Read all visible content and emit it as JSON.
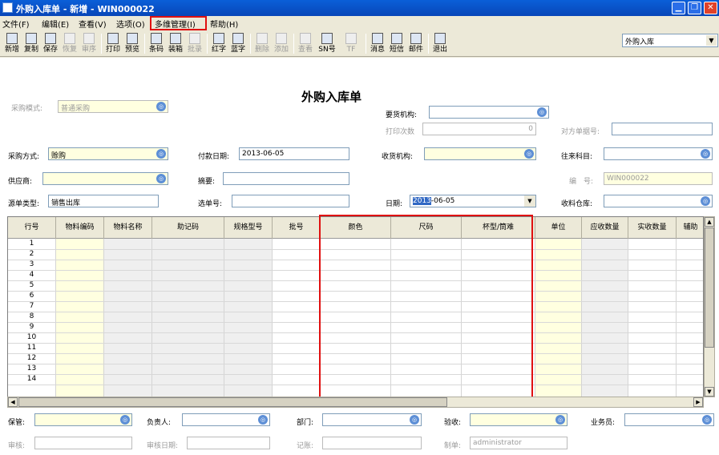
{
  "window": {
    "title": "外购入库单 - 新增 - WIN000022"
  },
  "menu": [
    "文件(F)",
    "编辑(E)",
    "查看(V)",
    "选项(O)",
    "多维管理(I)",
    "帮助(H)"
  ],
  "toolbar": {
    "buttons": [
      {
        "label": "新增",
        "icon": "new-doc-icon",
        "enabled": true
      },
      {
        "label": "复制",
        "icon": "copy-icon",
        "enabled": true
      },
      {
        "label": "保存",
        "icon": "save-icon",
        "enabled": true
      },
      {
        "label": "恢复",
        "icon": "undo-icon",
        "enabled": false
      },
      {
        "label": "审序",
        "icon": "sequence-icon",
        "enabled": false
      },
      {
        "label": "打印",
        "icon": "print-icon",
        "enabled": true
      },
      {
        "label": "预览",
        "icon": "preview-icon",
        "enabled": true
      },
      {
        "label": "条码",
        "icon": "barcode-icon",
        "enabled": true
      },
      {
        "label": "装箱",
        "icon": "box-icon",
        "enabled": true
      },
      {
        "label": "批录",
        "icon": "batch-icon",
        "enabled": false
      },
      {
        "label": "红字",
        "icon": "red-doc-icon",
        "enabled": true
      },
      {
        "label": "蓝字",
        "icon": "blue-doc-icon",
        "enabled": true
      },
      {
        "label": "删除",
        "icon": "delete-row-icon",
        "enabled": false
      },
      {
        "label": "添加",
        "icon": "add-row-icon",
        "enabled": false
      },
      {
        "label": "查看",
        "icon": "view-icon",
        "enabled": false
      },
      {
        "label": "SN号",
        "icon": "sn-icon",
        "enabled": true
      },
      {
        "label": "TF",
        "icon": "tf-icon",
        "enabled": false
      },
      {
        "label": "消息",
        "icon": "message-icon",
        "enabled": true
      },
      {
        "label": "短信",
        "icon": "sms-icon",
        "enabled": true
      },
      {
        "label": "邮件",
        "icon": "mail-icon",
        "enabled": true
      },
      {
        "label": "退出",
        "icon": "exit-icon",
        "enabled": true
      }
    ],
    "doc_type_select": "外购入库"
  },
  "form": {
    "doc_title": "外购入库单",
    "purchase_mode_label": "采购模式:",
    "purchase_mode_value": "普通采购",
    "request_org_label": "要货机构:",
    "request_org_value": "",
    "print_count_label": "打印次数",
    "print_count_value": "0",
    "counterparty_no_label": "对方单据号:",
    "counterparty_no_value": "",
    "purchase_method_label": "采购方式:",
    "purchase_method_value": "赊购",
    "pay_date_label": "付款日期:",
    "pay_date_value": "2013-06-05",
    "receive_org_label": "收货机构:",
    "receive_org_value": "",
    "account_label": "往来科目:",
    "account_value": "",
    "supplier_label": "供应商:",
    "supplier_value": "",
    "summary_label": "摘要:",
    "summary_value": "",
    "number_label": "编　号:",
    "number_value": "WIN000022",
    "source_type_label": "源单类型:",
    "source_type_value": "销售出库",
    "select_no_label": "选单号:",
    "select_no_value": "",
    "date_label": "日期:",
    "date_value_sel": "2013",
    "date_value_rest": "-06-05",
    "warehouse_label": "收料仓库:",
    "warehouse_value": ""
  },
  "grid": {
    "columns": [
      "行号",
      "物料编码",
      "物料名称",
      "助记码",
      "规格型号",
      "批号",
      "颜色",
      "尺码",
      "杯型/筒难",
      "单位",
      "应收数量",
      "实收数量",
      "辅助"
    ],
    "rows": [
      "1",
      "2",
      "3",
      "4",
      "5",
      "6",
      "7",
      "8",
      "9",
      "10",
      "11",
      "12",
      "13",
      "14"
    ]
  },
  "footer": {
    "keeper_label": "保管:",
    "keeper_value": "",
    "owner_label": "负责人:",
    "owner_value": "",
    "dept_label": "部门:",
    "dept_value": "",
    "check_label": "验收:",
    "check_value": "",
    "salesman_label": "业务员:",
    "salesman_value": "",
    "audit_label": "审核:",
    "audit_value": "",
    "audit_date_label": "审核日期:",
    "audit_date_value": "",
    "posting_label": "记账:",
    "posting_value": "",
    "maker_label": "制单:",
    "maker_value": "administrator"
  },
  "colors": {
    "title_bar": "#0a5fd8",
    "highlight_box": "#e01010",
    "required_field": "#ffffe0"
  }
}
